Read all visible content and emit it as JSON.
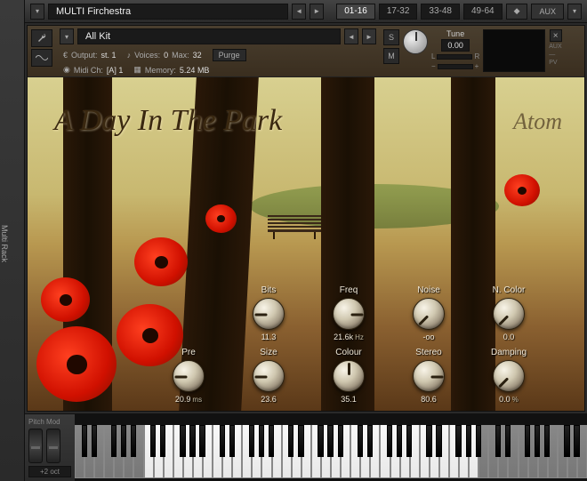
{
  "rack_label": "Multi Rack",
  "multi_name": "MULTI Firchestra",
  "pages": [
    "01-16",
    "17-32",
    "33-48",
    "49-64"
  ],
  "aux_label": "AUX",
  "instrument": {
    "kit_name": "All Kit",
    "output_label": "Output:",
    "output_value": "st. 1",
    "midi_label": "Midi Ch:",
    "midi_value": "[A] 1",
    "voices_label": "Voices:",
    "voices_value": "0",
    "max_label": "Max:",
    "max_value": "32",
    "memory_label": "Memory:",
    "memory_value": "5.24 MB",
    "purge_label": "Purge",
    "solo": "S",
    "mute": "M",
    "tune_label": "Tune",
    "tune_value": "0.00",
    "lr_l": "L",
    "lr_r": "R",
    "aux_tag": "AUX",
    "pv_tag": "PV"
  },
  "title_art": "A Day In The Park",
  "brand": "Atom",
  "knobs_row1": [
    {
      "label": "Bits",
      "value": "11.3",
      "suffix": "",
      "rot": "r-90"
    },
    {
      "label": "Freq",
      "value": "21.6k",
      "suffix": "Hz",
      "rot": "r90"
    },
    {
      "label": "Noise",
      "value": "-oo",
      "suffix": "",
      "rot": "r-135"
    },
    {
      "label": "N. Color",
      "value": "0.0",
      "suffix": "",
      "rot": "r-135"
    }
  ],
  "knobs_row2": [
    {
      "label": "Pre",
      "value": "20.9",
      "suffix": "ms",
      "rot": "r-90"
    },
    {
      "label": "Size",
      "value": "23.6",
      "suffix": "",
      "rot": "r-90"
    },
    {
      "label": "Colour",
      "value": "35.1",
      "suffix": "",
      "rot": "r-45"
    },
    {
      "label": "Stereo",
      "value": "80.6",
      "suffix": "",
      "rot": "r90"
    },
    {
      "label": "Damping",
      "value": "0.0",
      "suffix": "%",
      "rot": "r-135"
    }
  ],
  "pitch_mod_label": "Pitch Mod",
  "oct_label": "+2 oct"
}
